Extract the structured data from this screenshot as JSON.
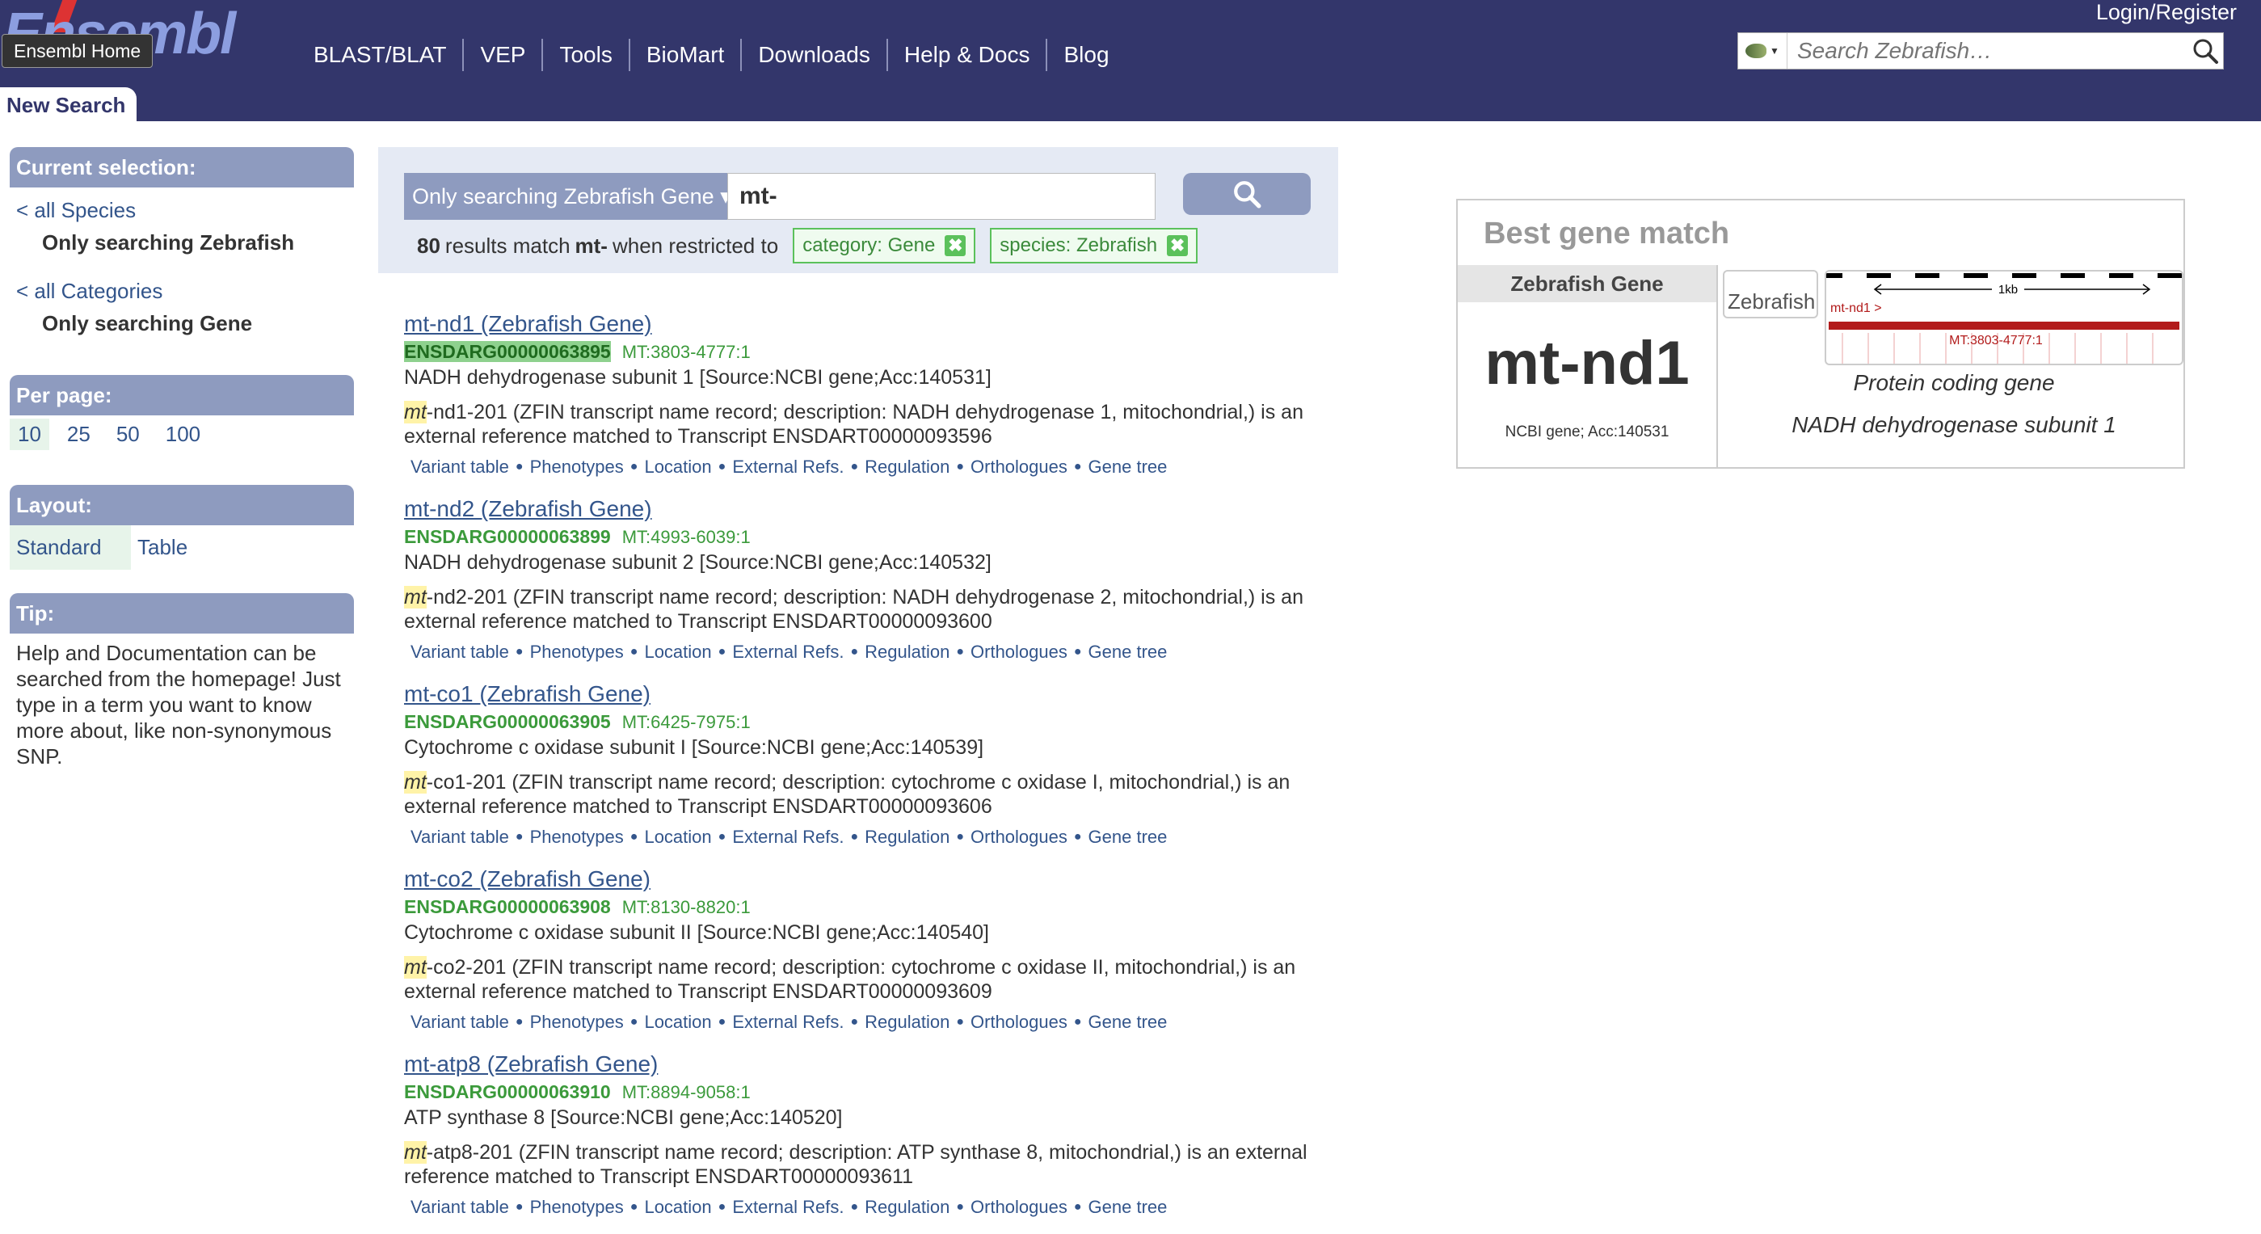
{
  "header": {
    "logo_text": "Ensembl",
    "home_tooltip": "Ensembl Home",
    "nav": [
      "BLAST/BLAT",
      "VEP",
      "Tools",
      "BioMart",
      "Downloads",
      "Help & Docs",
      "Blog"
    ],
    "login": "Login/Register",
    "search_placeholder": "Search Zebrafish…",
    "tab_label": "New Search"
  },
  "sidebar": {
    "current_selection": {
      "title": "Current selection:",
      "all_species_link": "< all Species",
      "species_selected": "Only searching Zebrafish",
      "all_categories_link": "< all Categories",
      "category_selected": "Only searching Gene"
    },
    "per_page": {
      "title": "Per page:",
      "options": [
        "10",
        "25",
        "50",
        "100"
      ],
      "selected": "10"
    },
    "layout": {
      "title": "Layout:",
      "options": [
        "Standard",
        "Table"
      ],
      "selected": "Standard"
    },
    "tip": {
      "title": "Tip:",
      "text": "Help and Documentation can be searched from the homepage! Just type in a term you want to know more about, like non-synonymous SNP."
    }
  },
  "search": {
    "scope_label": "Only searching Zebrafish Gene ▾",
    "query": "mt-",
    "count": "80",
    "summary_pre": "results match",
    "summary_query": "mt-",
    "summary_post": "when restricted to",
    "filters": [
      "category: Gene",
      "species: Zebrafish"
    ]
  },
  "results": [
    {
      "title": "mt-nd1 (Zebrafish Gene)",
      "id": "ENSDARG00000063895",
      "location": "MT:3803-4777:1",
      "description": "NADH dehydrogenase subunit 1 [Source:NCBI gene;Acc:140531]",
      "detail_mark": "mt",
      "detail_line1": "-nd1-201 (ZFIN transcript name record; description: NADH dehydrogenase 1, mitochondrial,) is an",
      "detail_line2": "external reference matched to Transcript ENSDART00000093596"
    },
    {
      "title": "mt-nd2 (Zebrafish Gene)",
      "id": "ENSDARG00000063899",
      "location": "MT:4993-6039:1",
      "description": "NADH dehydrogenase subunit 2 [Source:NCBI gene;Acc:140532]",
      "detail_mark": "mt",
      "detail_line1": "-nd2-201 (ZFIN transcript name record; description: NADH dehydrogenase 2, mitochondrial,) is an",
      "detail_line2": "external reference matched to Transcript ENSDART00000093600"
    },
    {
      "title": "mt-co1 (Zebrafish Gene)",
      "id": "ENSDARG00000063905",
      "location": "MT:6425-7975:1",
      "description": "Cytochrome c oxidase subunit I [Source:NCBI gene;Acc:140539]",
      "detail_mark": "mt",
      "detail_line1": "-co1-201 (ZFIN transcript name record; description: cytochrome c oxidase I, mitochondrial,) is an",
      "detail_line2": "external reference matched to Transcript ENSDART00000093606"
    },
    {
      "title": "mt-co2 (Zebrafish Gene)",
      "id": "ENSDARG00000063908",
      "location": "MT:8130-8820:1",
      "description": "Cytochrome c oxidase subunit II [Source:NCBI gene;Acc:140540]",
      "detail_mark": "mt",
      "detail_line1": "-co2-201 (ZFIN transcript name record; description: cytochrome c oxidase II, mitochondrial,) is an",
      "detail_line2": "external reference matched to Transcript ENSDART00000093609"
    },
    {
      "title": "mt-atp8 (Zebrafish Gene)",
      "id": "ENSDARG00000063910",
      "location": "MT:8894-9058:1",
      "description": "ATP synthase 8 [Source:NCBI gene;Acc:140520]",
      "detail_mark": "mt",
      "detail_line1": "-atp8-201 (ZFIN transcript name record; description: ATP synthase 8, mitochondrial,) is an external",
      "detail_line2": "reference matched to Transcript ENSDART00000093611"
    }
  ],
  "result_links": [
    "Variant table",
    "Phenotypes",
    "Location",
    "External Refs.",
    "Regulation",
    "Orthologues",
    "Gene tree"
  ],
  "best_match": {
    "title": "Best gene match",
    "species": "Zebrafish Gene",
    "symbol": "mt-nd1",
    "xref": "NCBI gene; Acc:140531",
    "image_alt": "Zebrafish",
    "track_scale": "1kb",
    "track_gene": "mt-nd1 >",
    "track_location": "MT:3803-4777:1",
    "biotype": "Protein coding gene",
    "description": "NADH dehydrogenase subunit 1"
  },
  "colors": {
    "masthead": "#33366b",
    "panel_header": "#8e9bbf",
    "link": "#33558b",
    "stable_id_green": "#3b9a3b",
    "filter_green": "#5bc15b",
    "highlight_yellow": "#fff3a8",
    "gene_track_red": "#b21b1b"
  }
}
